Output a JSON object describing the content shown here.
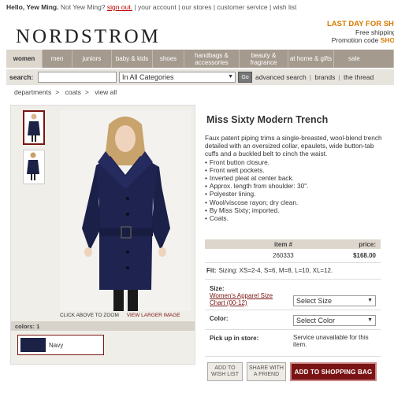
{
  "topbar": {
    "greeting": "Hello, Yew Ming.",
    "not_you": "Not Yew Ming?",
    "sign_out": "sign out.",
    "links": [
      "your account",
      "our stores",
      "customer service",
      "wish list"
    ]
  },
  "header": {
    "logo": "NORDSTROM",
    "promo_line1": "LAST DAY FOR SHOES",
    "promo_line2": "Free shipping with",
    "promo_line3_prefix": "Promotion code",
    "promo_code": "SHOES n"
  },
  "nav": {
    "items": [
      {
        "label": "women",
        "active": true
      },
      {
        "label": "men"
      },
      {
        "label": "juniors"
      },
      {
        "label": "baby & kids"
      },
      {
        "label": "shoes"
      },
      {
        "label": "handbags & accessories"
      },
      {
        "label": "beauty & fragrance"
      },
      {
        "label": "at home & gifts"
      },
      {
        "label": "sale"
      }
    ]
  },
  "search": {
    "label": "search:",
    "value": "",
    "category": "In All Categories",
    "go": "Go",
    "links": [
      "advanced search",
      "brands",
      "the thread"
    ]
  },
  "breadcrumb": [
    "departments",
    "coats",
    "view all"
  ],
  "product": {
    "title": "Miss Sixty Modern Trench",
    "description": "Faux patent piping trims a single-breasted, wool-blend trench detailed with an oversized collar, epaulets, wide button-tab cuffs and a buckled belt to cinch the waist.",
    "bullets": [
      "Front button closure.",
      "Front welt pockets.",
      "Inverted pleat at center back.",
      "Approx. length from shoulder: 30\".",
      "Polyester lining.",
      "Wool/viscose rayon; dry clean.",
      "By Miss Sixty; imported.",
      "Coats."
    ],
    "item_header": "item #",
    "price_header": "price:",
    "item_number": "260333",
    "price": "$168.00",
    "fit_label": "Fit:",
    "fit_value": "Sizing: XS=2-4, S=6, M=8, L=10, XL=12.",
    "size_label": "Size:",
    "size_chart_link": "Women's Apparel Size Chart (00-12)",
    "size_select": "Select Size",
    "color_label": "Color:",
    "color_select": "Select Color",
    "pickup_label": "Pick up in store:",
    "pickup_value": "Service unavailable for this item."
  },
  "gallery": {
    "click_zoom": "CLICK ABOVE TO ZOOM",
    "view_larger": "VIEW LARGER IMAGE",
    "colors_label": "colors: 1",
    "swatch_name": "Navy",
    "swatch_color": "#1c2146"
  },
  "actions": {
    "wish_list": "ADD TO WISH LIST",
    "share": "SHARE WITH A FRIEND",
    "add_to_bag": "ADD TO SHOPPING BAG"
  },
  "colors": {
    "accent": "#7a1414",
    "nav_bg": "#a49a8e",
    "promo": "#d97a00"
  }
}
